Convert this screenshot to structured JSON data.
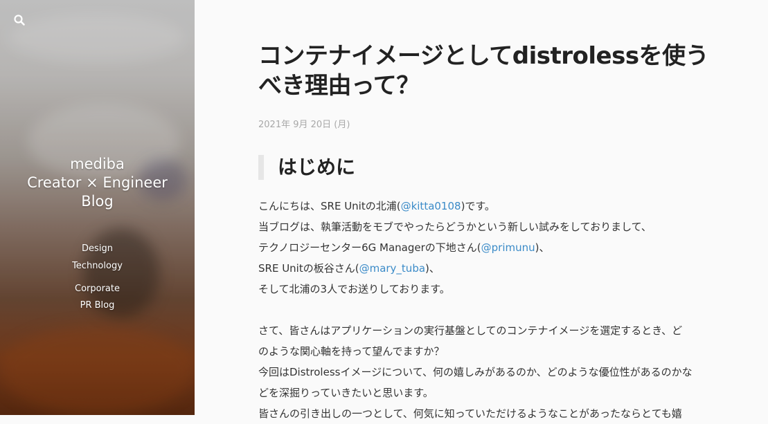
{
  "sidebar": {
    "brand_lines": [
      "mediba",
      "Creator × Engineer",
      "Blog"
    ],
    "nav_primary": [
      "Design",
      "Technology"
    ],
    "nav_secondary": [
      "Corporate",
      "PR Blog"
    ],
    "search_icon": "search-icon"
  },
  "post": {
    "title": "コンテナイメージとしてdistrolessを使うべき理由って？",
    "date": "2021年 9月 20日 (月)",
    "heading": "はじめに",
    "p1_a": "こんにちは、SRE Unitの北浦(",
    "p1_link": "@kitta0108",
    "p1_b": ")です。",
    "p2": "当ブログは、執筆活動をモブでやったらどうかという新しい試みをしておりまして、",
    "p3_a": "テクノロジーセンター6G Managerの下地さん(",
    "p3_link": "@primunu",
    "p3_b": ")、",
    "p4_a": "SRE Unitの板谷さん(",
    "p4_link": "@mary_tuba",
    "p4_b": ")、",
    "p5": "そして北浦の3人でお送りしております。",
    "p6": "さて、皆さんはアプリケーションの実行基盤としてのコンテナイメージを選定するとき、ど",
    "p7": "のような関心軸を持って望んでますか？",
    "p8": "今回はDistrolessイメージについて、何の嬉しみがあるのか、どのような優位性があるのかな",
    "p9": "どを深掘りっていきたいと思います。",
    "p10": "皆さんの引き出しの一つとして、何気に知っていただけるようなことがあったならとても嬉"
  },
  "colors": {
    "link": "#3b8bc8",
    "date": "#a8a8a8",
    "heading_bar": "#e6e6e6",
    "background": "#fafafa"
  }
}
